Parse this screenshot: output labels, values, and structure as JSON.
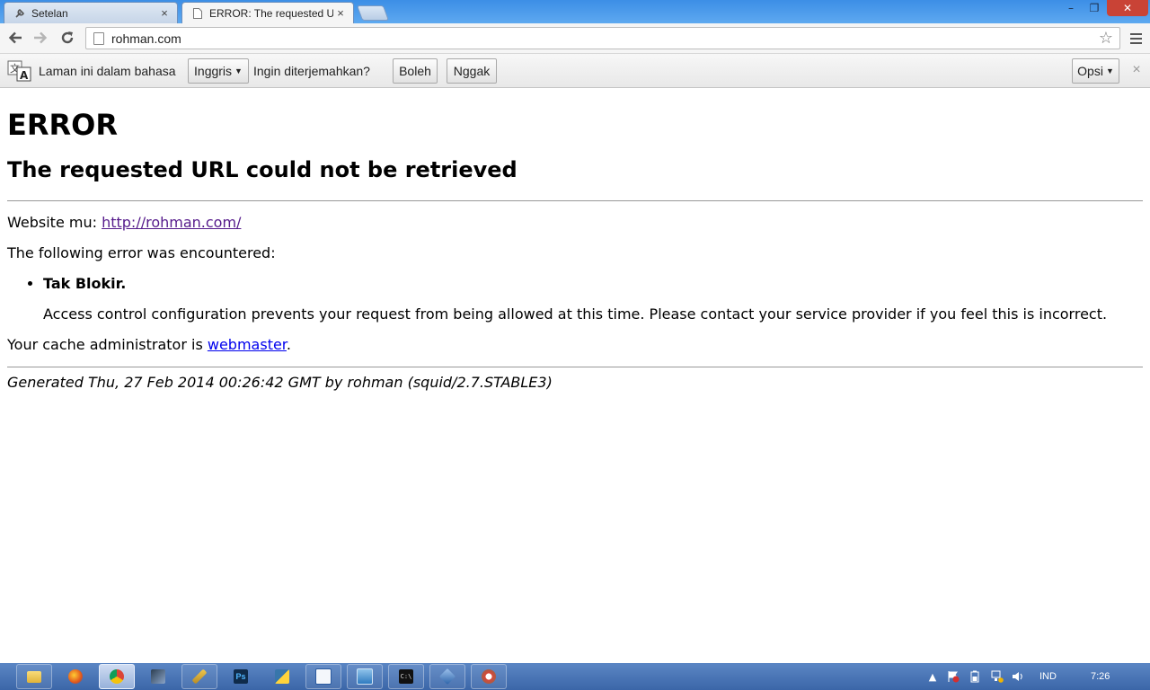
{
  "browser": {
    "tabs": [
      {
        "title": "Setelan",
        "close": "×"
      },
      {
        "title": "ERROR: The requested URI",
        "close": "×"
      }
    ],
    "window_controls": {
      "minimize": "–",
      "maximize": "❐",
      "close": "✕"
    },
    "address": "rohman.com"
  },
  "translate_bar": {
    "text_before": "Laman ini dalam bahasa",
    "language": "Inggris",
    "question": "Ingin diterjemahkan?",
    "yes_label": "Boleh",
    "no_label": "Nggak",
    "options_label": "Opsi",
    "close": "×"
  },
  "page": {
    "h1": "ERROR",
    "h2": "The requested URL could not be retrieved",
    "website_label": "Website mu:",
    "website_url": "http://rohman.com/",
    "following": "The following error was encountered:",
    "error_title": "Tak Blokir.",
    "error_desc": "Access control configuration prevents your request from being allowed at this time. Please contact your service provider if you feel this is incorrect.",
    "cache_before": "Your cache administrator is ",
    "cache_link": "webmaster",
    "cache_after": ".",
    "generated": "Generated Thu, 27 Feb 2014 00:26:42 GMT by rohman (squid/2.7.STABLE3)"
  },
  "taskbar": {
    "apps": [
      "folder-icon",
      "firefox-icon",
      "chrome-icon",
      "media-icon",
      "sketch-icon",
      "photoshop-icon",
      "python-icon",
      "writer-icon",
      "network-icon",
      "cmd-icon",
      "virtualbox-icon",
      "gimp-icon"
    ],
    "photoshop_label": "Ps",
    "cmd_label": "C:\\",
    "language": "IND",
    "clock": "7:26"
  },
  "colors": {
    "link_visited": "#551a8b",
    "link": "#0000ee",
    "taskbar": "#3b66a8",
    "close_button": "#c94336"
  }
}
